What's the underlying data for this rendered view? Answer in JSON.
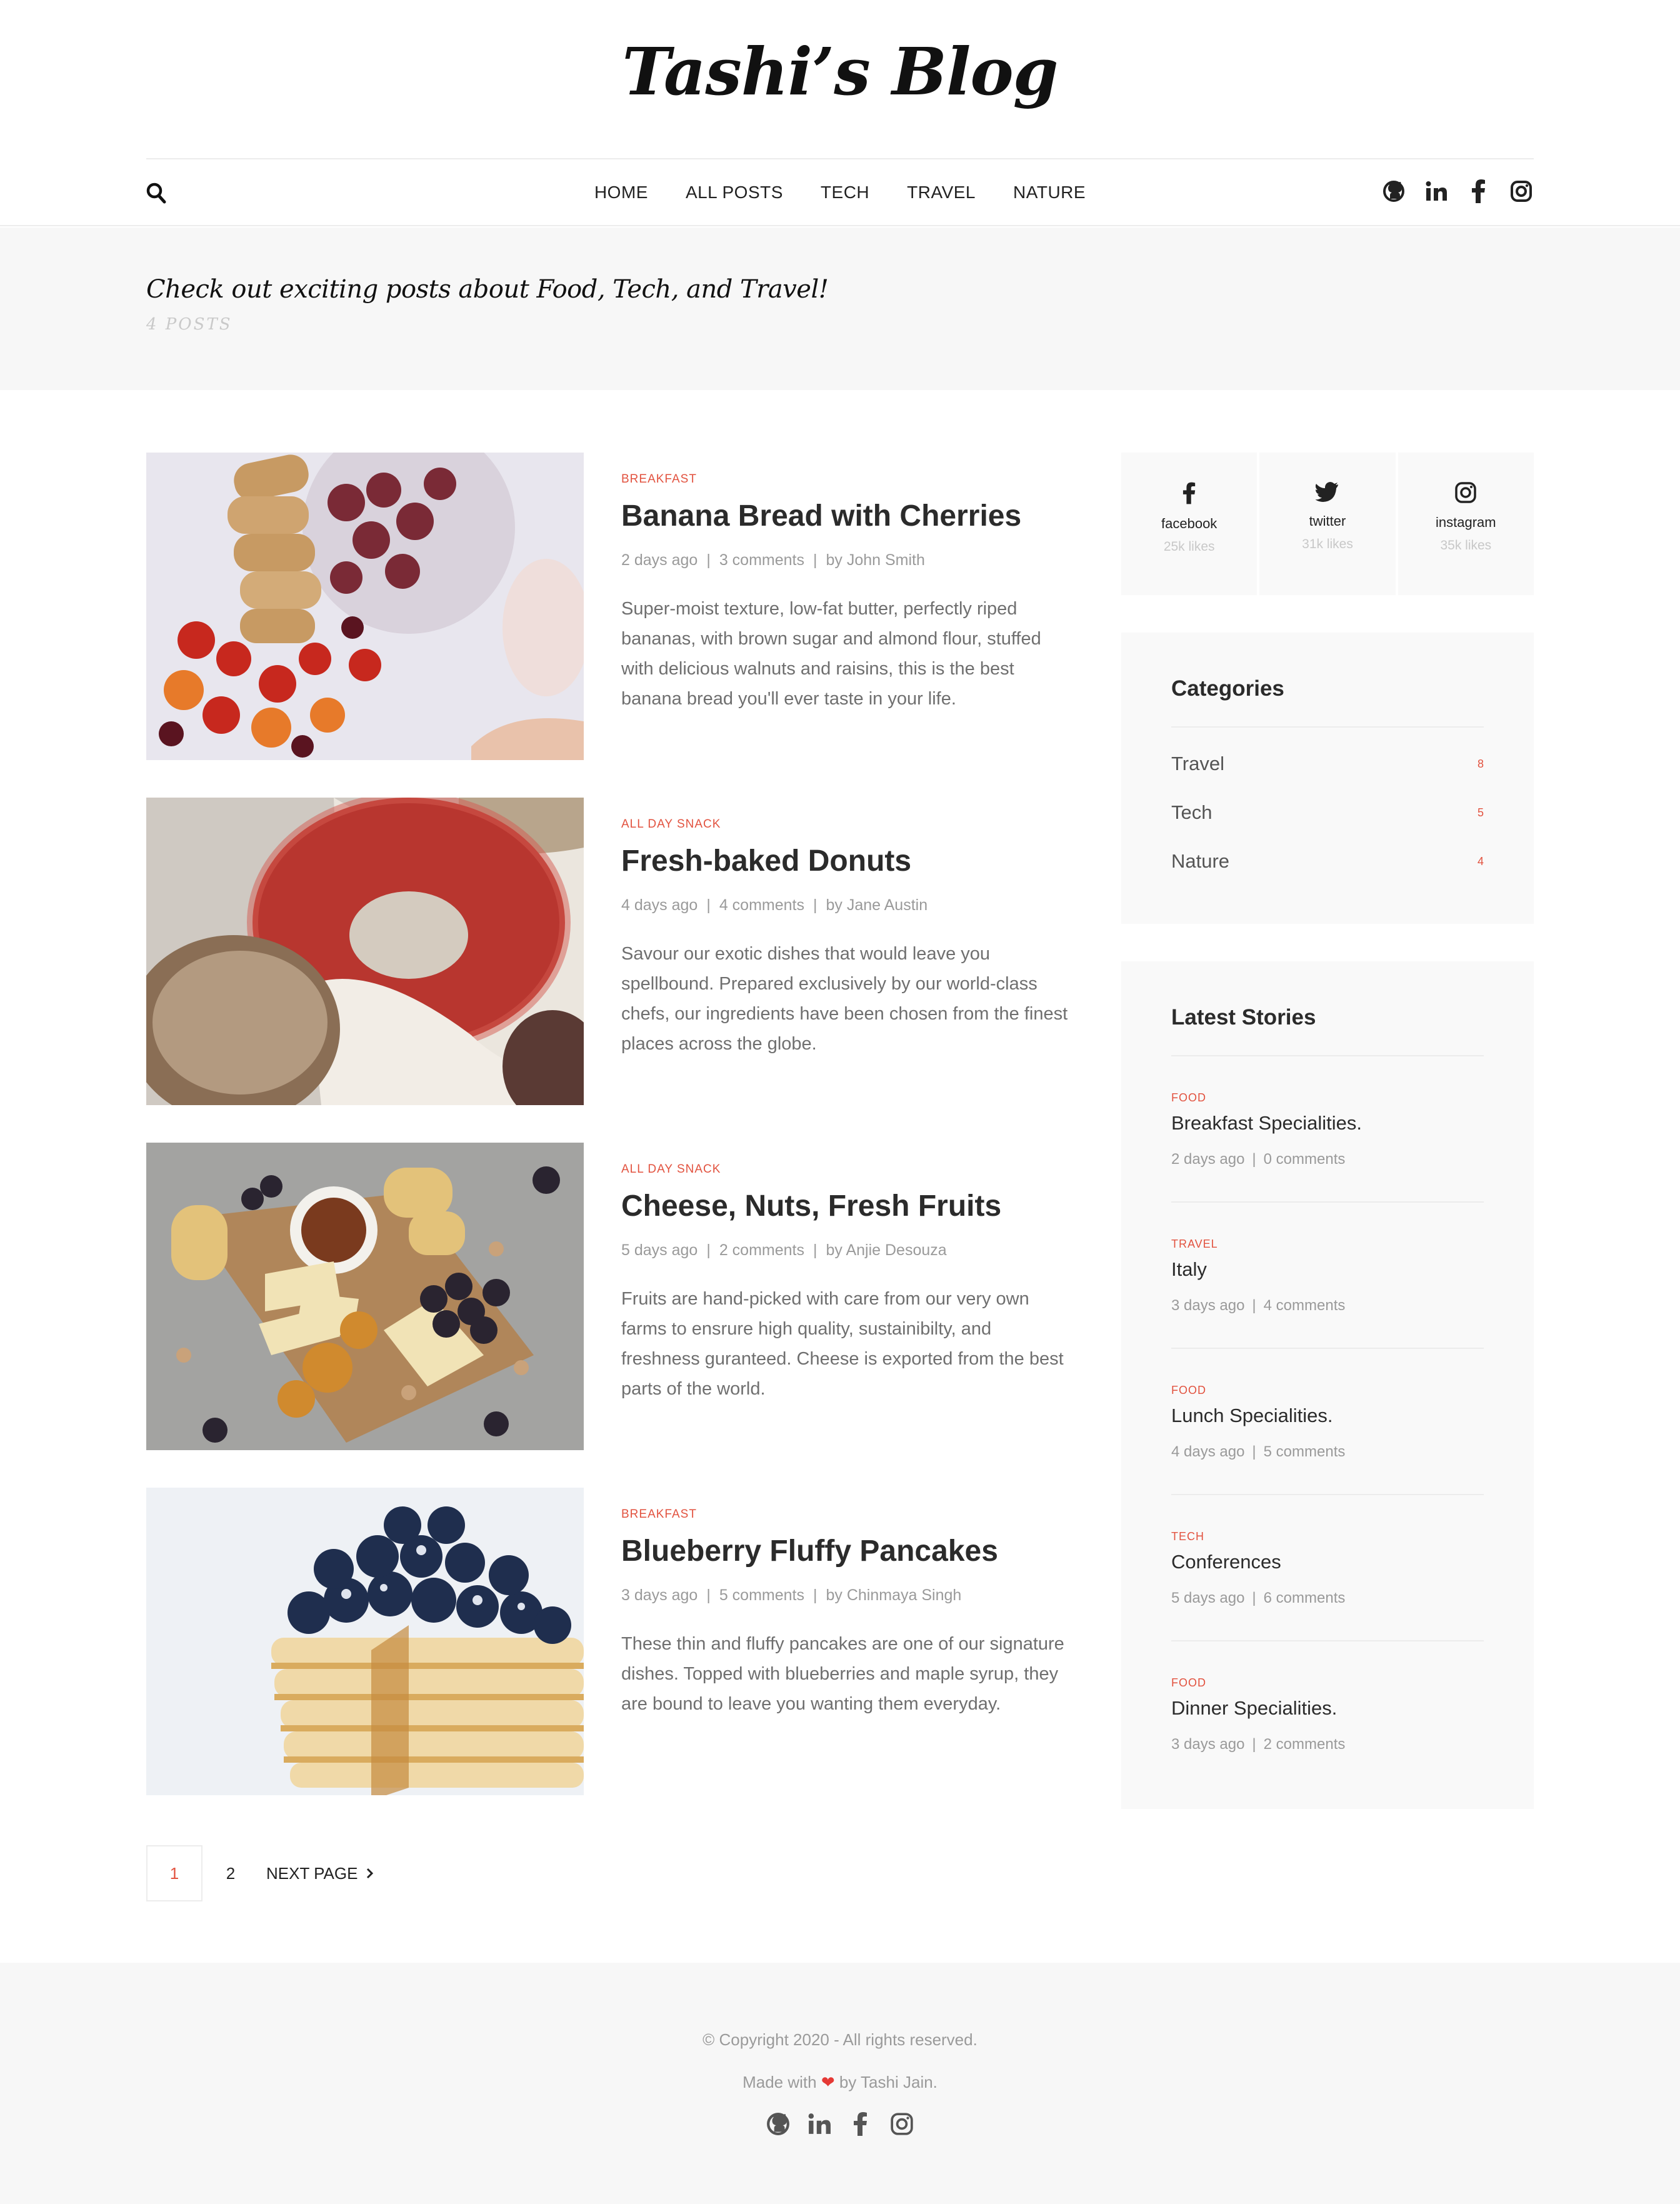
{
  "brand": "Tashi’s Blog",
  "nav": [
    "HOME",
    "ALL POSTS",
    "TECH",
    "TRAVEL",
    "NATURE"
  ],
  "hero": {
    "title": "Check out exciting posts about Food, Tech, and Travel!",
    "count": "4 POSTS"
  },
  "posts": [
    {
      "category": "BREAKFAST",
      "title": "Banana Bread with Cherries",
      "date": "2 days ago",
      "comments": "3 comments",
      "author": "by John Smith",
      "excerpt": "Super-moist texture, low-fat butter, perfectly riped bananas, with brown sugar and almond flour, stuffed with delicious walnuts and raisins, this is the best banana bread you'll ever taste in your life."
    },
    {
      "category": "ALL DAY SNACK",
      "title": "Fresh-baked Donuts",
      "date": "4 days ago",
      "comments": "4 comments",
      "author": "by Jane Austin",
      "excerpt": "Savour our exotic dishes that would leave you spellbound. Prepared exclusively by our world-class chefs, our ingredients have been chosen from the finest places across the globe."
    },
    {
      "category": "ALL DAY SNACK",
      "title": "Cheese, Nuts, Fresh Fruits",
      "date": "5 days ago",
      "comments": "2 comments",
      "author": "by Anjie Desouza",
      "excerpt": "Fruits are hand-picked with care from our very own farms to ensrure high quality, sustainibilty, and freshness guranteed. Cheese is exported from the best parts of the world."
    },
    {
      "category": "BREAKFAST",
      "title": "Blueberry Fluffy Pancakes",
      "date": "3 days ago",
      "comments": "5 comments",
      "author": "by Chinmaya Singh",
      "excerpt": "These thin and fluffy pancakes are one of our signature dishes. Topped with blueberries and maple syrup, they are bound to leave you wanting them everyday."
    }
  ],
  "pagination": {
    "current": "1",
    "next_number": "2",
    "next_label": "NEXT PAGE"
  },
  "social": [
    {
      "name": "facebook",
      "likes": "25k likes",
      "icon": "facebook-icon"
    },
    {
      "name": "twitter",
      "likes": "31k likes",
      "icon": "twitter-icon"
    },
    {
      "name": "instagram",
      "likes": "35k likes",
      "icon": "instagram-icon"
    }
  ],
  "categories": {
    "title": "Categories",
    "items": [
      {
        "label": "Travel",
        "count": "8"
      },
      {
        "label": "Tech",
        "count": "5"
      },
      {
        "label": "Nature",
        "count": "4"
      }
    ]
  },
  "latest": {
    "title": "Latest Stories",
    "items": [
      {
        "category": "FOOD",
        "title": "Breakfast Specialities.",
        "date": "2 days ago",
        "comments": "0 comments"
      },
      {
        "category": "TRAVEL",
        "title": "Italy",
        "date": "3 days ago",
        "comments": "4 comments"
      },
      {
        "category": "FOOD",
        "title": "Lunch Specialities.",
        "date": "4 days ago",
        "comments": "5 comments"
      },
      {
        "category": "TECH",
        "title": "Conferences",
        "date": "5 days ago",
        "comments": "6 comments"
      },
      {
        "category": "FOOD",
        "title": "Dinner Specialities.",
        "date": "3 days ago",
        "comments": "2 comments"
      }
    ]
  },
  "footer": {
    "copyright": "© Copyright 2020 - All rights reserved.",
    "made_prefix": "Made with",
    "heart": "❤",
    "made_suffix": "by Tashi Jain."
  },
  "colors": {
    "accent": "#e2523f",
    "muted": "#9a9a9a",
    "panel": "#f9f9f9"
  }
}
